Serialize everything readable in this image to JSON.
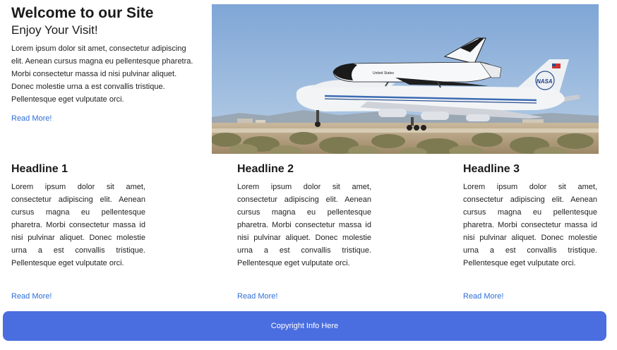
{
  "hero": {
    "title": "Welcome to our Site",
    "subtitle": "Enjoy Your Visit!",
    "body": "Lorem ipsum dolor sit amet, consectetur adipiscing elit. Aenean cursus magna eu pellentesque pharetra. Morbi consectetur massa id nisi pulvinar aliquet. Donec molestie urna a est convallis tristique. Pellentesque eget vulputate orci.",
    "link": "Read More!"
  },
  "photo": {
    "shuttle_label": "United States",
    "tail_logo": "NASA"
  },
  "columns": [
    {
      "headline": "Headline 1",
      "body": "Lorem ipsum dolor sit amet, consectetur adipiscing elit. Aenean cursus magna eu pellentesque pharetra. Morbi consectetur massa id nisi pulvinar aliquet. Donec molestie urna a est convallis tristique. Pellentesque eget vulputate orci.",
      "link": "Read More!"
    },
    {
      "headline": "Headline 2",
      "body": "Lorem ipsum dolor sit amet, consectetur adipiscing elit. Aenean cursus magna eu pellentesque pharetra. Morbi consectetur massa id nisi pulvinar aliquet. Donec molestie urna a est convallis tristique. Pellentesque eget vulputate orci.",
      "link": "Read More!"
    },
    {
      "headline": "Headline 3",
      "body": "Lorem ipsum dolor sit amet, consectetur adipiscing elit. Aenean cursus magna eu pellentesque pharetra. Morbi consectetur massa id nisi pulvinar aliquet. Donec molestie urna a est convallis tristique. Pellentesque eget vulputate orci.",
      "link": "Read More!"
    }
  ],
  "footer": {
    "text": "Copyright Info Here"
  },
  "colors": {
    "link": "#2f6fd6",
    "footer_bg": "#4a6ee0",
    "sky": "#8fb3dd"
  }
}
